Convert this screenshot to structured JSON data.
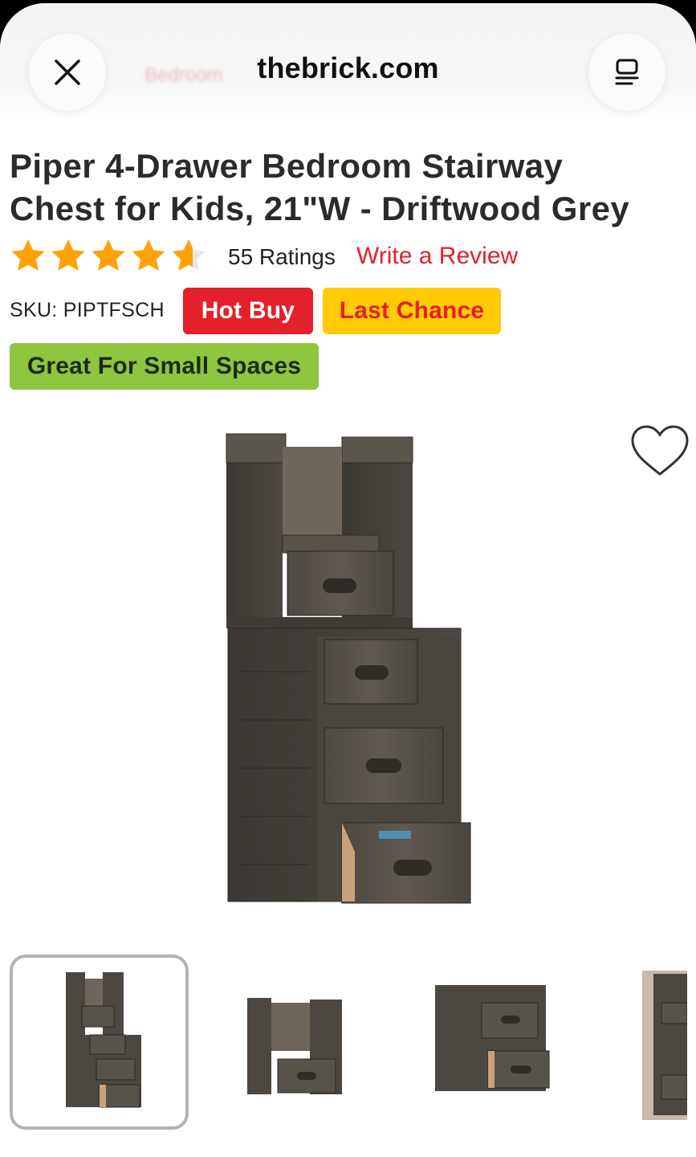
{
  "browser": {
    "host": "thebrick.com",
    "background_breadcrumb": "Bedroom",
    "close_icon": "close-icon",
    "tabs_icon": "reader-icon"
  },
  "product": {
    "title": "Piper 4-Drawer Bedroom Stairway Chest for Kids, 21\"W - Driftwood Grey",
    "rating": 4.5,
    "rating_max": 5,
    "ratings_label": "55 Ratings",
    "write_review_label": "Write a Review",
    "sku_label": "SKU: PIPTFSCH",
    "badges": [
      {
        "label": "Hot Buy",
        "bg": "#e3202b",
        "fg": "#ffffff"
      },
      {
        "label": "Last Chance",
        "bg": "#ffcb05",
        "fg": "#e3202b"
      },
      {
        "label": "Great For Small Spaces",
        "bg": "#8dc63f",
        "fg": "#1c2a10"
      }
    ],
    "favorite_icon": "heart-icon",
    "star_color": "#ffa10a",
    "thumbnails_count": 4,
    "selected_thumbnail": 1
  }
}
